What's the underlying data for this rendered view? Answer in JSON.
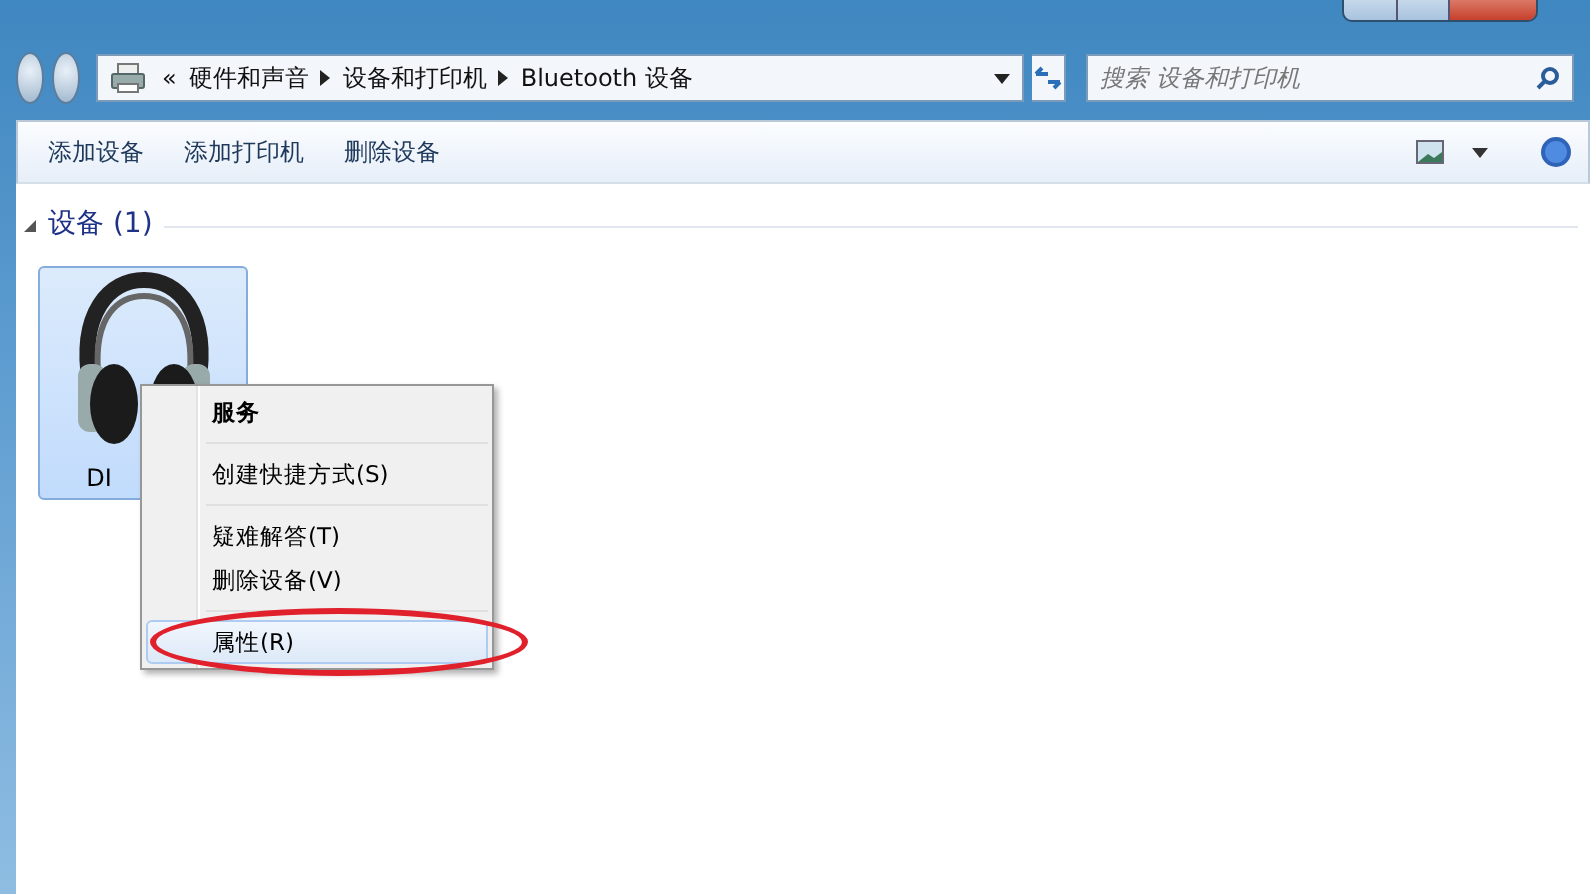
{
  "address_bar": {
    "overflow": "«",
    "breadcrumbs": [
      "硬件和声音",
      "设备和打印机",
      "Bluetooth 设备"
    ]
  },
  "search": {
    "placeholder": "搜索 设备和打印机"
  },
  "toolbar": {
    "buttons": [
      "添加设备",
      "添加打印机",
      "删除设备"
    ]
  },
  "group": {
    "title": "设备 (1)",
    "expanded": true
  },
  "devices": [
    {
      "label": "DI",
      "selected": true
    }
  ],
  "context_menu": {
    "items": [
      {
        "kind": "item",
        "label": "服务",
        "bold": true,
        "selected": false
      },
      {
        "kind": "separator"
      },
      {
        "kind": "item",
        "label": "创建快捷方式(S)",
        "bold": false,
        "selected": false
      },
      {
        "kind": "separator"
      },
      {
        "kind": "item",
        "label": "疑难解答(T)",
        "bold": false,
        "selected": false
      },
      {
        "kind": "item",
        "label": "删除设备(V)",
        "bold": false,
        "selected": false
      },
      {
        "kind": "separator"
      },
      {
        "kind": "item",
        "label": "属性(R)",
        "bold": false,
        "selected": true
      }
    ]
  }
}
